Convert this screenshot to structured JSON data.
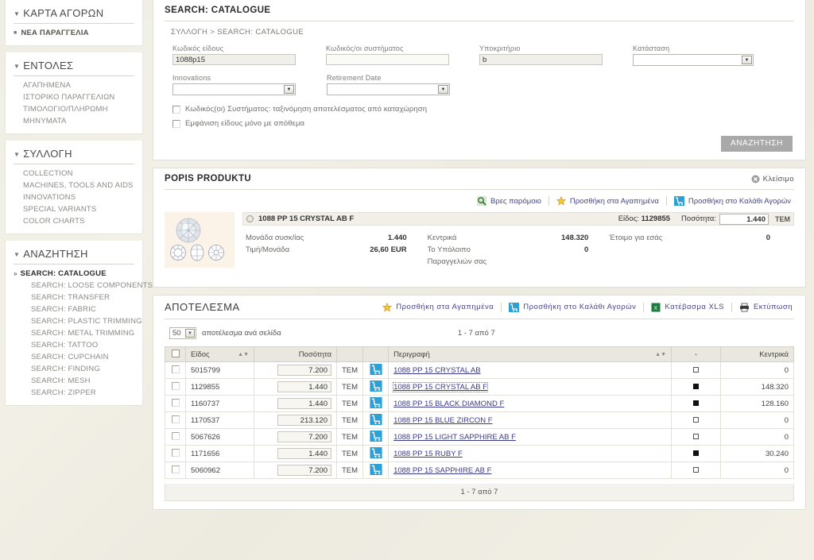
{
  "sidebar": {
    "blocks": [
      {
        "title": "ΚΑΡΤΑ ΑΓΟΡΩΝ",
        "items": [
          {
            "label": "ΝΕΑ ΠΑΡΑΓΓΕΛΙΑ",
            "style": "bullet"
          }
        ]
      },
      {
        "title": "ΕΝΤΟΛΕΣ",
        "items": [
          {
            "label": "ΑΓΑΠΗΜΕΝΑ",
            "style": "plain"
          },
          {
            "label": "ΙΣΤΟΡΙΚΟ ΠΑΡΑΓΓΕΛΙΩΝ",
            "style": "plain"
          },
          {
            "label": "ΤΙΜΟΛΟΓΙΟ/ΠΛΗΡΩΜΗ",
            "style": "plain"
          },
          {
            "label": "ΜΗΝΥΜΑΤΑ",
            "style": "plain"
          }
        ]
      },
      {
        "title": "ΣΥΛΛΟΓΗ",
        "items": [
          {
            "label": "COLLECTION",
            "style": "plain"
          },
          {
            "label": "MACHINES, TOOLS AND AIDS",
            "style": "plain"
          },
          {
            "label": "INNOVATIONS",
            "style": "plain"
          },
          {
            "label": "SPECIAL VARIANTS",
            "style": "plain"
          },
          {
            "label": "COLOR CHARTS",
            "style": "plain"
          }
        ]
      },
      {
        "title": "ΑΝΑΖΗΤΗΣΗ",
        "items": [
          {
            "label": "SEARCH: CATALOGUE",
            "style": "active"
          },
          {
            "label": "SEARCH: LOOSE COMPONENTS",
            "style": "sub"
          },
          {
            "label": "SEARCH: TRANSFER",
            "style": "sub"
          },
          {
            "label": "SEARCH: FABRIC",
            "style": "sub"
          },
          {
            "label": "SEARCH: PLASTIC TRIMMING",
            "style": "sub"
          },
          {
            "label": "SEARCH: METAL TRIMMING",
            "style": "sub"
          },
          {
            "label": "SEARCH: TATTOO",
            "style": "sub"
          },
          {
            "label": "SEARCH: CUPCHAIN",
            "style": "sub"
          },
          {
            "label": "SEARCH: FINDING",
            "style": "sub"
          },
          {
            "label": "SEARCH: MESH",
            "style": "sub"
          },
          {
            "label": "SEARCH: ZIPPER",
            "style": "sub"
          }
        ]
      }
    ]
  },
  "search_panel": {
    "title": "SEARCH: CATALOGUE",
    "breadcrumb": "ΣΥΛΛΟΓΗ  >  SEARCH: CATALOGUE",
    "fields": {
      "item_code": {
        "label": "Κωδικός είδους",
        "value": "1088p15"
      },
      "system_code": {
        "label": "Κωδικός/οι συστήματος",
        "value": ""
      },
      "subcriteria": {
        "label": "Υποκριτήριο",
        "value": "b"
      },
      "status": {
        "label": "Κατάσταση",
        "value": ""
      },
      "innovations": {
        "label": "Innovations",
        "value": ""
      },
      "retirement_date": {
        "label": "Retirement Date",
        "value": ""
      }
    },
    "checkboxes": [
      {
        "label": "Κωδικός(οι) Συστήματος: ταξινόμηση αποτελέσματος από καταχώρηση",
        "checked": false
      },
      {
        "label": "Εμφάνιση είδους μόνο με απόθεμα",
        "checked": false
      }
    ],
    "search_button": "ΑΝΑΖΗΤΗΣΗ"
  },
  "product_panel": {
    "title": "POPIS PRODUKTU",
    "close_label": "Κλείσιμο",
    "tools": [
      {
        "label": "Βρες παρόμοιο",
        "icon": "find-similar-icon"
      },
      {
        "label": "Προσθήκη στα Αγαπημένα",
        "icon": "star-icon"
      },
      {
        "label": "Προσθήκη στο Καλάθι Αγορών",
        "icon": "cart-icon"
      }
    ],
    "product_name": "1088 PP 15 CRYSTAL AB F",
    "item_label": "Είδος:",
    "item_number": "1129855",
    "qty_label": "Ποσότητα:",
    "qty_value": "1.440",
    "unit": "TEM",
    "stats": [
      {
        "label": "Μονάδα συσκ/ίας",
        "value": "1.440"
      },
      {
        "label": "Τιμή/Μονάδα",
        "value": "26,60 EUR"
      },
      {
        "label": "Κεντρικά",
        "value": "148.320"
      },
      {
        "label": "Το Υπόλοιπο",
        "value": "0"
      },
      {
        "label": "Παραγγελιών σας",
        "value": ""
      },
      {
        "label": "Έτοιμο για εσάς",
        "value": "0"
      }
    ]
  },
  "results_panel": {
    "title": "ΑΠΟΤΕΛΕΣΜΑ",
    "tools": [
      {
        "label": "Προσθήκη στα Αγαπημένα",
        "icon": "star-icon"
      },
      {
        "label": "Προσθήκη στο Καλάθι Αγορών",
        "icon": "cart-icon"
      },
      {
        "label": "Κατέβασμα XLS",
        "icon": "xls-icon"
      },
      {
        "label": "Εκτύπωση",
        "icon": "printer-icon"
      }
    ],
    "per_page": "50",
    "per_page_label": "αποτέλεσμα ανά σελίδα",
    "count_top": "1 - 7  από 7",
    "count_bottom": "1 - 7  από 7",
    "columns": [
      "",
      "Είδος",
      "Ποσότητα",
      "",
      "",
      "Περιγραφή",
      "-",
      "Κεντρικά"
    ],
    "unit": "TEM",
    "rows": [
      {
        "eidos": "5015799",
        "qty": "7.200",
        "desc": "1088 PP 15 CRYSTAL AB",
        "stock": "empty",
        "kentrika": "0",
        "selected": false
      },
      {
        "eidos": "1129855",
        "qty": "1.440",
        "desc": "1088 PP 15 CRYSTAL AB F",
        "stock": "filled",
        "kentrika": "148.320",
        "selected": true
      },
      {
        "eidos": "1160737",
        "qty": "1.440",
        "desc": "1088 PP 15 BLACK DIAMOND F",
        "stock": "filled",
        "kentrika": "128.160",
        "selected": false
      },
      {
        "eidos": "1170537",
        "qty": "213.120",
        "desc": "1088 PP 15 BLUE ZIRCON F",
        "stock": "empty",
        "kentrika": "0",
        "selected": false
      },
      {
        "eidos": "5067626",
        "qty": "7.200",
        "desc": "1088 PP 15 LIGHT SAPPHIRE AB F",
        "stock": "empty",
        "kentrika": "0",
        "selected": false
      },
      {
        "eidos": "1171656",
        "qty": "1.440",
        "desc": "1088 PP 15 RUBY F",
        "stock": "filled",
        "kentrika": "30.240",
        "selected": false
      },
      {
        "eidos": "5060962",
        "qty": "7.200",
        "desc": "1088 PP 15 SAPPHIRE AB F",
        "stock": "empty",
        "kentrika": "0",
        "selected": false
      }
    ]
  },
  "colors": {
    "accent_link": "#3a3a8a",
    "cart_icon": "#2c9fd4",
    "button": "#a9a9a9",
    "panel_bg": "#ffffff",
    "page_bg": "#efeee4"
  }
}
